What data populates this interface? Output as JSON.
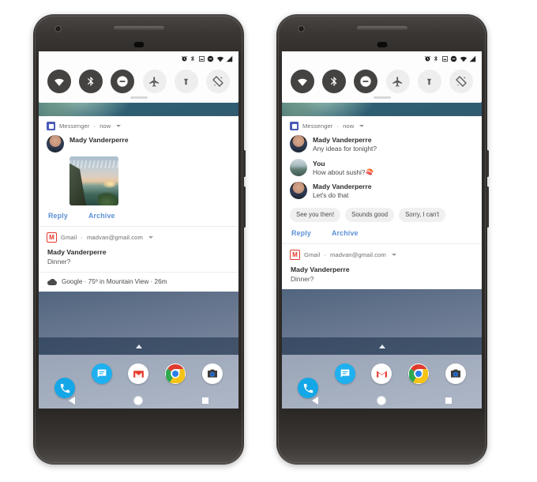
{
  "scene": {
    "title": "Android notification shade — bundled and expanded message notification",
    "phone_count": 2
  },
  "status_bar": {
    "icons": [
      "alarm-icon",
      "bluetooth-icon",
      "screenshot-icon",
      "do-not-disturb-icon",
      "wifi-icon",
      "signal-icon"
    ]
  },
  "quick_settings": {
    "tiles": [
      {
        "name": "wifi",
        "label": "Wi-Fi",
        "state": "on"
      },
      {
        "name": "bluetooth",
        "label": "Bluetooth",
        "state": "on"
      },
      {
        "name": "do-not-disturb",
        "label": "Do Not Disturb",
        "state": "on"
      },
      {
        "name": "airplane",
        "label": "Airplane mode",
        "state": "off"
      },
      {
        "name": "flashlight",
        "label": "Flashlight",
        "state": "off"
      },
      {
        "name": "auto-rotate",
        "label": "Auto-rotate",
        "state": "off"
      }
    ]
  },
  "left_phone": {
    "messenger_notification": {
      "app": "Messenger",
      "separator": "·",
      "time": "now",
      "sender": "Mady Vanderperre",
      "has_photo": true,
      "actions": [
        "Reply",
        "Archive"
      ]
    },
    "gmail_notification": {
      "app": "Gmail",
      "separator": "·",
      "account": "madvan@gmail.com",
      "title": "Mady Vanderperre",
      "subject": "Dinner?"
    },
    "google_notification": {
      "app": "Google",
      "text": "Google · 75º in Mountain View · 26m"
    }
  },
  "right_phone": {
    "messenger_notification": {
      "app": "Messenger",
      "separator": "·",
      "time": "now",
      "messages": [
        {
          "sender": "Mady Vanderperre",
          "text": "Any ideas for tonight?",
          "avatar": "mady"
        },
        {
          "sender": "You",
          "text": "How about sushi?",
          "emoji": "🍣",
          "avatar": "you"
        },
        {
          "sender": "Mady Vanderperre",
          "text": "Let's do that",
          "avatar": "mady"
        }
      ],
      "smart_replies": [
        "See you then!",
        "Sounds good",
        "Sorry, I can't"
      ],
      "actions": [
        "Reply",
        "Archive"
      ]
    },
    "gmail_notification": {
      "app": "Gmail",
      "separator": "·",
      "account": "madvan@gmail.com",
      "title": "Mady Vanderperre",
      "subject": "Dinner?"
    }
  },
  "dock": {
    "apps": [
      "phone-app",
      "messages-app",
      "gmail-app",
      "chrome-app",
      "camera-app"
    ]
  },
  "navbar": {
    "buttons": [
      "back-button",
      "home-button",
      "recents-button"
    ]
  },
  "colors": {
    "action_blue": "#5b8fd6",
    "messenger_purple": "#4a5ab5",
    "gmail_red": "#e5392c",
    "chip_gray": "#f0f0f0"
  }
}
